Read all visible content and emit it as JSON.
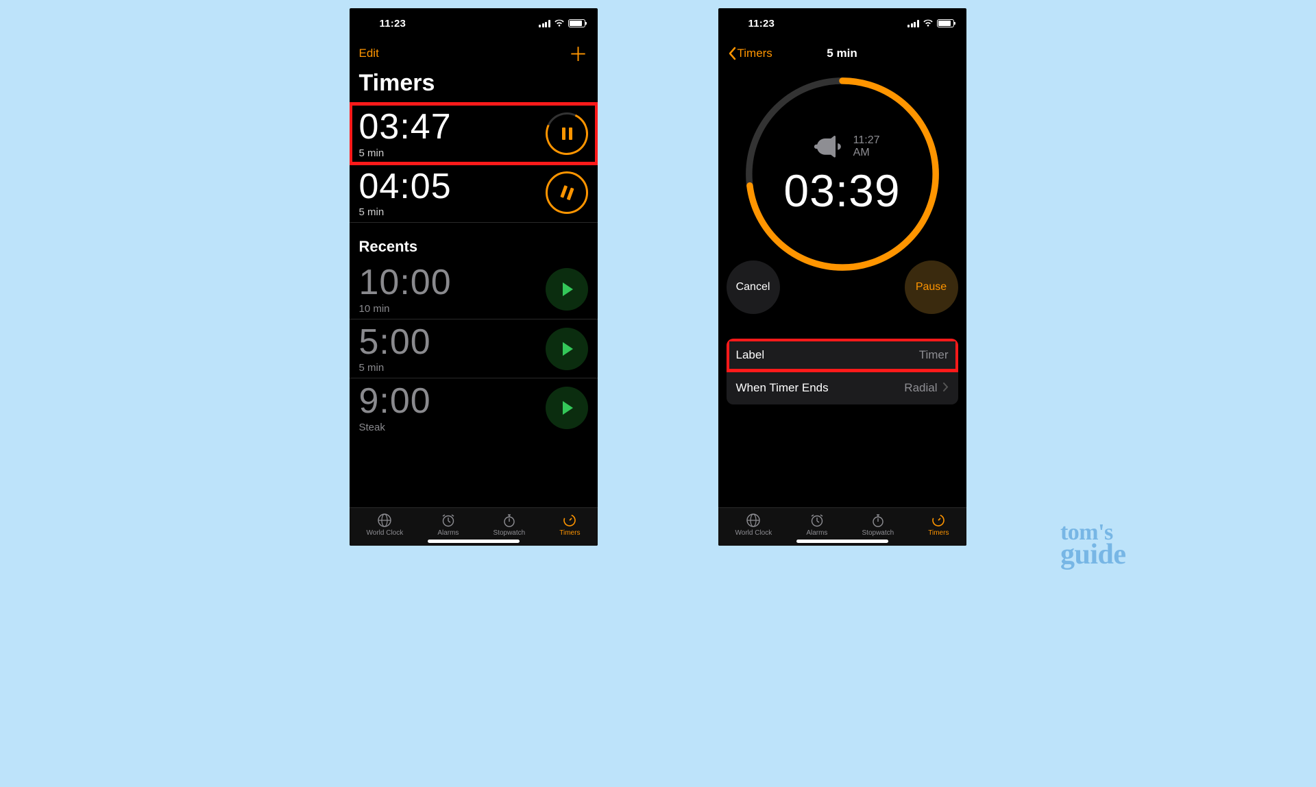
{
  "status": {
    "time": "11:23"
  },
  "watermark": {
    "line1": "tom's",
    "line2": "guide"
  },
  "left": {
    "edit": "Edit",
    "title": "Timers",
    "active_timers": [
      {
        "time": "03:47",
        "label": "5 min",
        "highlighted": true
      },
      {
        "time": "04:05",
        "label": "5 min",
        "highlighted": false
      }
    ],
    "recents_header": "Recents",
    "recents": [
      {
        "time": "10:00",
        "label": "10 min"
      },
      {
        "time": "5:00",
        "label": "5 min"
      },
      {
        "time": "9:00",
        "label": "Steak"
      }
    ]
  },
  "right": {
    "back_label": "Timers",
    "title": "5 min",
    "end_time": "11:27 AM",
    "remaining": "03:39",
    "progress_fraction": 0.73,
    "cancel": "Cancel",
    "pause": "Pause",
    "settings": {
      "label_key": "Label",
      "label_value": "Timer",
      "ends_key": "When Timer Ends",
      "ends_value": "Radial"
    }
  },
  "tabs": [
    {
      "id": "world-clock",
      "label": "World Clock"
    },
    {
      "id": "alarms",
      "label": "Alarms"
    },
    {
      "id": "stopwatch",
      "label": "Stopwatch"
    },
    {
      "id": "timers",
      "label": "Timers",
      "active": true
    }
  ],
  "colors": {
    "accent": "#ff9500",
    "highlight": "#ff1a1a",
    "green": "#34c759"
  }
}
